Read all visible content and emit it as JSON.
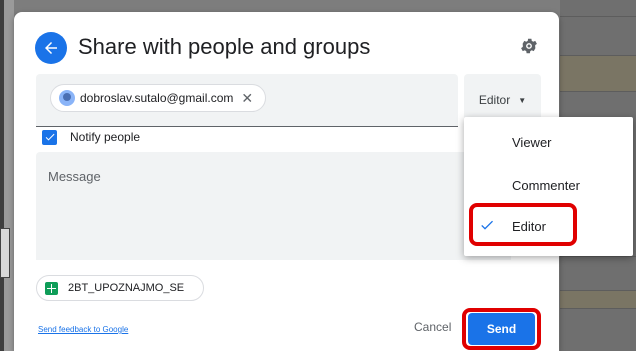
{
  "dialog": {
    "title": "Share with people and groups",
    "recipient": {
      "email": "dobroslav.sutalo@gmail.com",
      "remove_glyph": "✕"
    },
    "role_button": {
      "label": "Editor"
    },
    "notify": {
      "label": "Notify people",
      "checked": true
    },
    "message": {
      "placeholder": "Message"
    },
    "file": {
      "name": "2BT_UPOZNAJMO_SE"
    },
    "feedback_link": "Send feedback to Google",
    "cancel_label": "Cancel",
    "send_label": "Send"
  },
  "role_menu": {
    "items": [
      {
        "label": "Viewer",
        "selected": false
      },
      {
        "label": "Commenter",
        "selected": false
      },
      {
        "label": "Editor",
        "selected": true
      }
    ]
  },
  "colors": {
    "accent": "#1a73e8",
    "highlight": "#e00000",
    "sheets_green": "#0f9d58"
  },
  "icons": [
    "back-arrow-icon",
    "gear-icon",
    "avatar-icon",
    "close-icon",
    "chevron-down-icon",
    "checkbox-icon",
    "sheets-icon",
    "checkmark-icon"
  ]
}
